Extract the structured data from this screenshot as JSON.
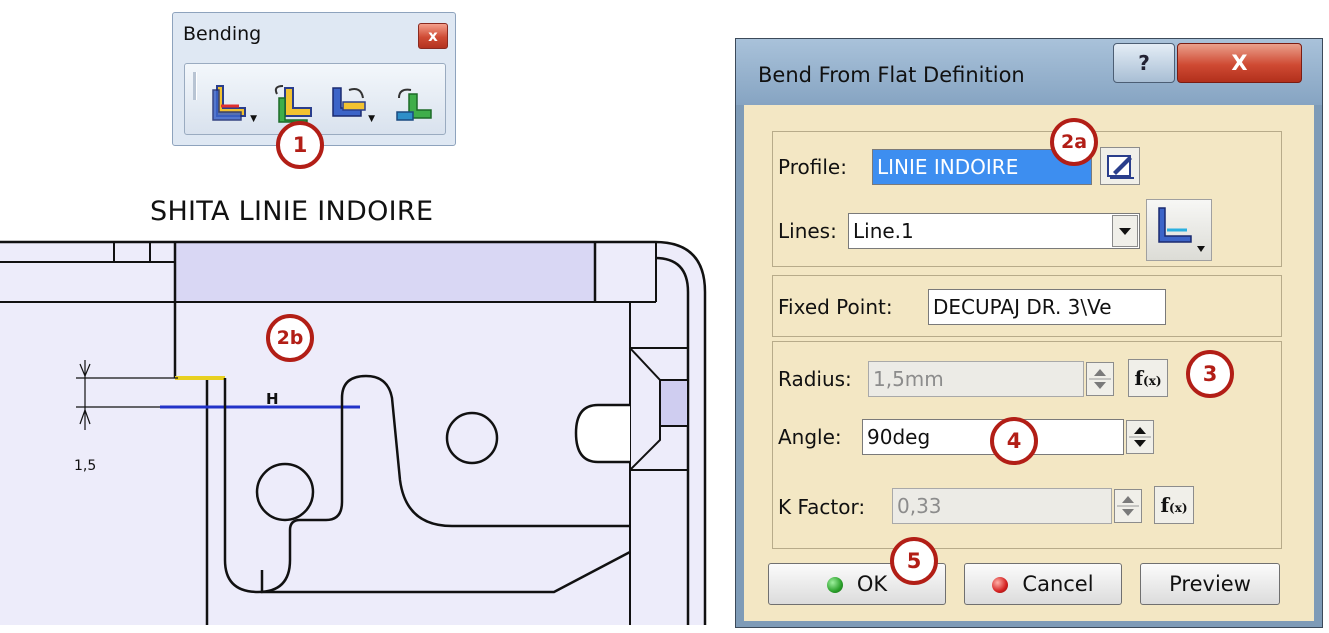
{
  "toolbar": {
    "title": "Bending",
    "close_glyph": "x",
    "tools": [
      {
        "icon": "bend-from-flat-icon",
        "has_dropdown": true
      },
      {
        "icon": "bend-icon",
        "has_dropdown": false
      },
      {
        "icon": "unfold-icon",
        "has_dropdown": true
      },
      {
        "icon": "fold-icon",
        "has_dropdown": false
      }
    ]
  },
  "sketch": {
    "title": "SHITA LINIE INDOIRE",
    "h_label": "H",
    "dimension_value": "1,5"
  },
  "dialog": {
    "title": "Bend From Flat Definition",
    "help_glyph": "?",
    "close_glyph": "X",
    "profile": {
      "label": "Profile:",
      "value": "LINIE INDOIRE"
    },
    "lines": {
      "label": "Lines:",
      "value": "Line.1"
    },
    "fixed_point": {
      "label": "Fixed Point:",
      "value": "DECUPAJ DR. 3\\Ve"
    },
    "radius": {
      "label": "Radius:",
      "value": "1,5mm"
    },
    "angle": {
      "label": "Angle:",
      "value": "90deg"
    },
    "k_factor": {
      "label": "K Factor:",
      "value": "0,33"
    },
    "fx_label": "f",
    "fx_sub": "(x)",
    "buttons": {
      "ok": "OK",
      "cancel": "Cancel",
      "preview": "Preview"
    }
  },
  "callouts": {
    "c1": "1",
    "c2a": "2a",
    "c2b": "2b",
    "c3": "3",
    "c4": "4",
    "c5": "5"
  },
  "colors": {
    "callout": "#b21e16",
    "part_fill": "#ecebfa",
    "selected_line": "#2233c8",
    "ok_led": "#2aa02a",
    "cancel_led": "#d42020"
  }
}
